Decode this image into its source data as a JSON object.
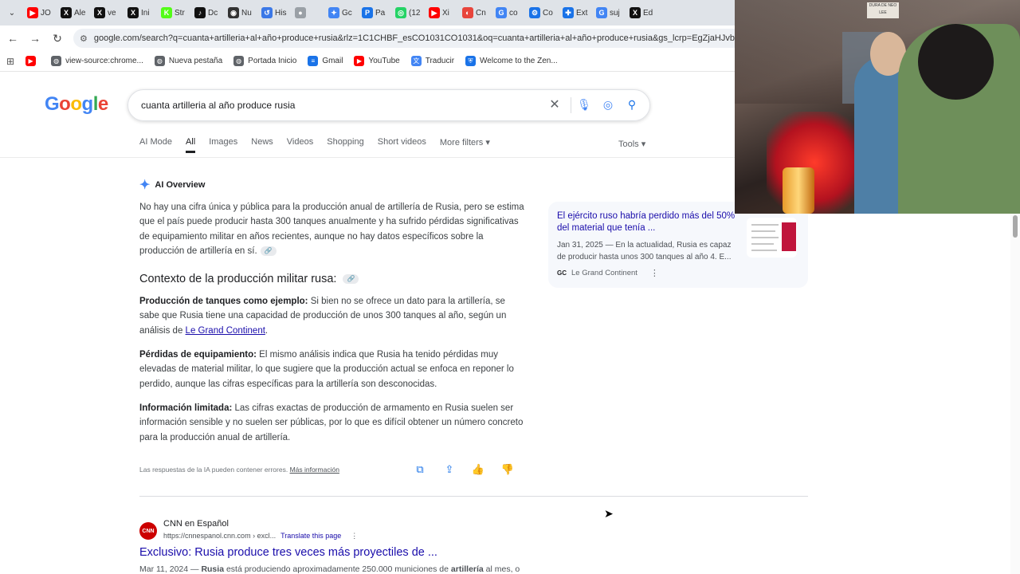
{
  "tabs": [
    {
      "label": "JO",
      "icon": "youtube-icon",
      "color": "#ff0000"
    },
    {
      "label": "Ale",
      "icon": "x-icon",
      "color": "#111111"
    },
    {
      "label": "ve",
      "icon": "x-icon",
      "color": "#111111"
    },
    {
      "label": "Ini",
      "icon": "x-icon",
      "color": "#111111"
    },
    {
      "label": "Str",
      "icon": "kick-icon",
      "color": "#53fc18"
    },
    {
      "label": "Dc",
      "icon": "tiktok-icon",
      "color": "#111111"
    },
    {
      "label": "Nu",
      "icon": "github-icon",
      "color": "#333333"
    },
    {
      "label": "His",
      "icon": "history-icon",
      "color": "#3b78e7"
    },
    {
      "label": "",
      "icon": "loading-icon",
      "color": "#9aa0a6"
    },
    {
      "label": "Gc",
      "icon": "gemini-icon",
      "color": "#4285f4"
    },
    {
      "label": "Pa",
      "icon": "page-icon",
      "color": "#1a73e8"
    },
    {
      "label": "(12",
      "icon": "whatsapp-icon",
      "color": "#25d366"
    },
    {
      "label": "Xi",
      "icon": "youtube-icon",
      "color": "#ff0000"
    },
    {
      "label": "Cn",
      "icon": "chrome-icon",
      "color": "#e8453c"
    },
    {
      "label": "co",
      "icon": "google-icon",
      "color": "#4285f4"
    },
    {
      "label": "Co",
      "icon": "gear-icon",
      "color": "#1a73e8"
    },
    {
      "label": "Ext",
      "icon": "puzzle-icon",
      "color": "#1a73e8"
    },
    {
      "label": "suj",
      "icon": "google-icon",
      "color": "#4285f4"
    },
    {
      "label": "Ed",
      "icon": "x-icon",
      "color": "#111111"
    }
  ],
  "address_bar": {
    "url": "google.com/search?q=cuanta+artilleria+al+año+produce+rusia&rlz=1C1CHBF_esCO1031CO1031&oq=cuanta+artilleria+al+año+produce+rusia&gs_lcrp=EgZjaHJvbWUy"
  },
  "bookmarks": [
    {
      "label": "",
      "icon": "youtube-icon",
      "color": "#ff0000"
    },
    {
      "label": "view-source:chrome...",
      "icon": "globe-icon",
      "color": "#5f6368"
    },
    {
      "label": "Nueva pestaña",
      "icon": "globe-icon",
      "color": "#5f6368"
    },
    {
      "label": "Portada Inicio",
      "icon": "globe-icon",
      "color": "#5f6368"
    },
    {
      "label": "Gmail",
      "icon": "gmail-icon",
      "color": "#1a73e8"
    },
    {
      "label": "YouTube",
      "icon": "youtube-icon",
      "color": "#ff0000"
    },
    {
      "label": "Traducir",
      "icon": "translate-icon",
      "color": "#4285f4"
    },
    {
      "label": "Welcome to the Zen...",
      "icon": "shield-icon",
      "color": "#1a73e8"
    }
  ],
  "search": {
    "logo": "Google",
    "query": "cuanta artilleria al año produce rusia"
  },
  "filters": {
    "items": [
      "AI Mode",
      "Images",
      "News",
      "Videos",
      "Shopping",
      "Short videos",
      "More filters ▾"
    ],
    "active": "All",
    "tools": "Tools ▾"
  },
  "ai_overview": {
    "heading": "AI Overview",
    "intro": "No hay una cifra única y pública para la producción anual de artillería de Rusia, pero se estima que el país puede producir hasta 300 tanques anualmente y ha sufrido pérdidas significativas de equipamiento militar en años recientes, aunque no hay datos específicos sobre la producción de artillería en sí.",
    "subheading": "Contexto de la producción militar rusa:",
    "point1_bold": "Producción de tanques como ejemplo:",
    "point1_text": " Si bien no se ofrece un dato para la artillería, se sabe que Rusia tiene una capacidad de producción de unos 300 tanques al año, según un análisis de ",
    "point1_link": "Le Grand Continent",
    "point1_end": ".",
    "point2_bold": "Pérdidas de equipamiento:",
    "point2_text": " El mismo análisis indica que Rusia ha tenido pérdidas muy elevadas de material militar, lo que sugiere que la producción actual se enfoca en reponer lo perdido, aunque las cifras específicas para la artillería son desconocidas.",
    "point3_bold": "Información limitada:",
    "point3_text": " Las cifras exactas de producción de armamento en Rusia suelen ser información sensible y no suelen ser públicas, por lo que es difícil obtener un número concreto para la producción anual de artillería.",
    "disclaimer": "Las respuestas de la IA pueden contener errores.",
    "more_info": "Más información"
  },
  "source_card": {
    "title": "El ejército ruso habría perdido más del 50% del material que tenía ...",
    "snippet": "Jan 31, 2025 — En la actualidad, Rusia es capaz de producir hasta unos 300 tanques al año 4. E...",
    "source_abbr": "GC",
    "source": "Le Grand Continent"
  },
  "result": {
    "logo": "CNN",
    "site": "CNN en Español",
    "url": "https://cnnespanol.cnn.com › excl...",
    "translate": "Translate this page",
    "title": "Exclusivo: Rusia produce tres veces más proyectiles de ...",
    "snippet_date": "Mar 11, 2024 — ",
    "snippet_b1": "Rusia",
    "snippet_mid": " está produciendo aproximadamente 250.000 municiones de ",
    "snippet_b2": "artillería",
    "snippet_end": " al mes, o"
  },
  "webcam": {
    "sign_text": "DURA DE NEO LEE"
  }
}
